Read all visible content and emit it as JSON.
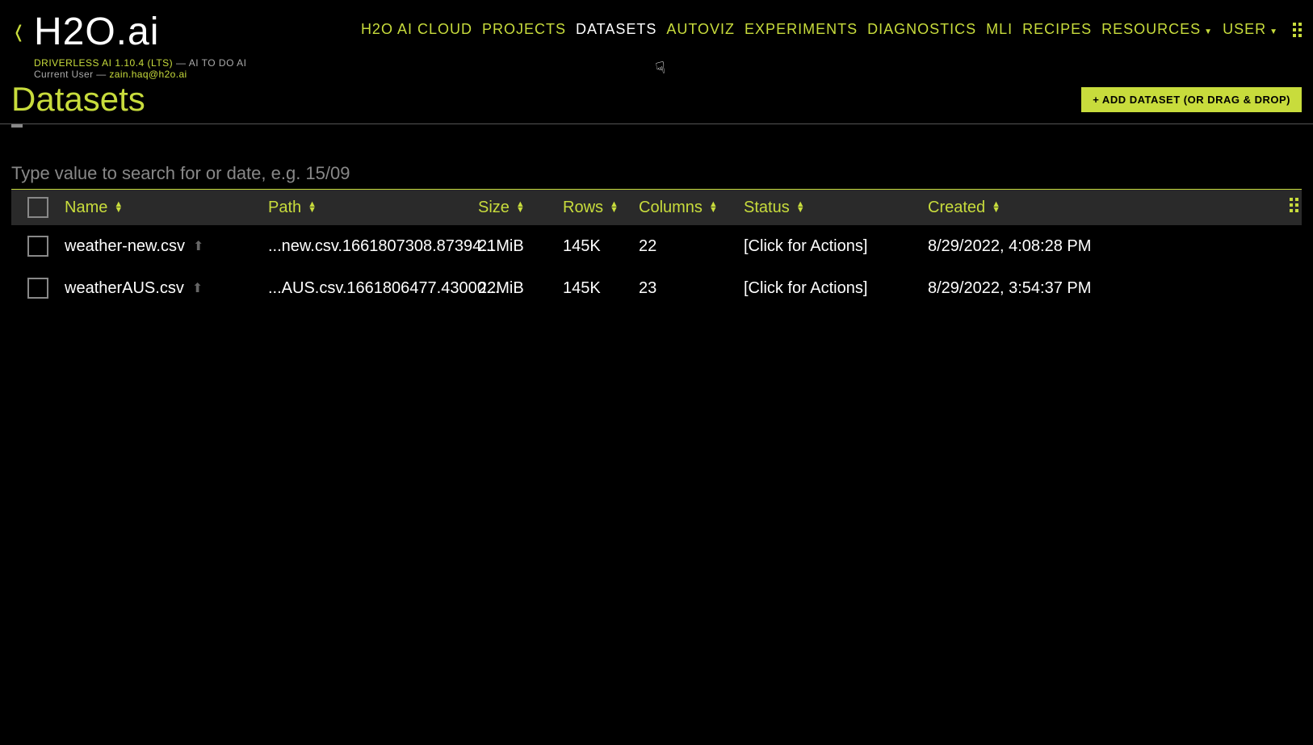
{
  "header": {
    "brand": "H2O.ai",
    "version_line_a": "DRIVERLESS AI 1.10.4 (LTS)",
    "version_line_b": "AI TO DO AI",
    "current_user_label": "Current User",
    "current_user_email": "zain.haq@h2o.ai"
  },
  "nav": {
    "items": [
      {
        "label": "H2O AI CLOUD",
        "active": false
      },
      {
        "label": "PROJECTS",
        "active": false
      },
      {
        "label": "DATASETS",
        "active": true
      },
      {
        "label": "AUTOVIZ",
        "active": false
      },
      {
        "label": "EXPERIMENTS",
        "active": false
      },
      {
        "label": "DIAGNOSTICS",
        "active": false
      },
      {
        "label": "MLI",
        "active": false
      },
      {
        "label": "RECIPES",
        "active": false
      },
      {
        "label": "RESOURCES",
        "active": false,
        "dropdown": true
      },
      {
        "label": "USER",
        "active": false,
        "dropdown": true
      }
    ]
  },
  "page": {
    "title": "Datasets",
    "add_button": "+ ADD DATASET (OR DRAG & DROP)"
  },
  "search": {
    "placeholder": "Type value to search for or date, e.g. 15/09"
  },
  "table": {
    "columns": {
      "name": "Name",
      "path": "Path",
      "size": "Size",
      "rows": "Rows",
      "columns": "Columns",
      "status": "Status",
      "created": "Created"
    },
    "rows": [
      {
        "name": "weather-new.csv",
        "path": "...new.csv.1661807308.87394...",
        "size": "21MiB",
        "rows": "145K",
        "columns": "22",
        "status": "[Click for Actions]",
        "created": "8/29/2022, 4:08:28 PM"
      },
      {
        "name": "weatherAUS.csv",
        "path": "...AUS.csv.1661806477.43000...",
        "size": "22MiB",
        "rows": "145K",
        "columns": "23",
        "status": "[Click for Actions]",
        "created": "8/29/2022, 3:54:37 PM"
      }
    ]
  }
}
